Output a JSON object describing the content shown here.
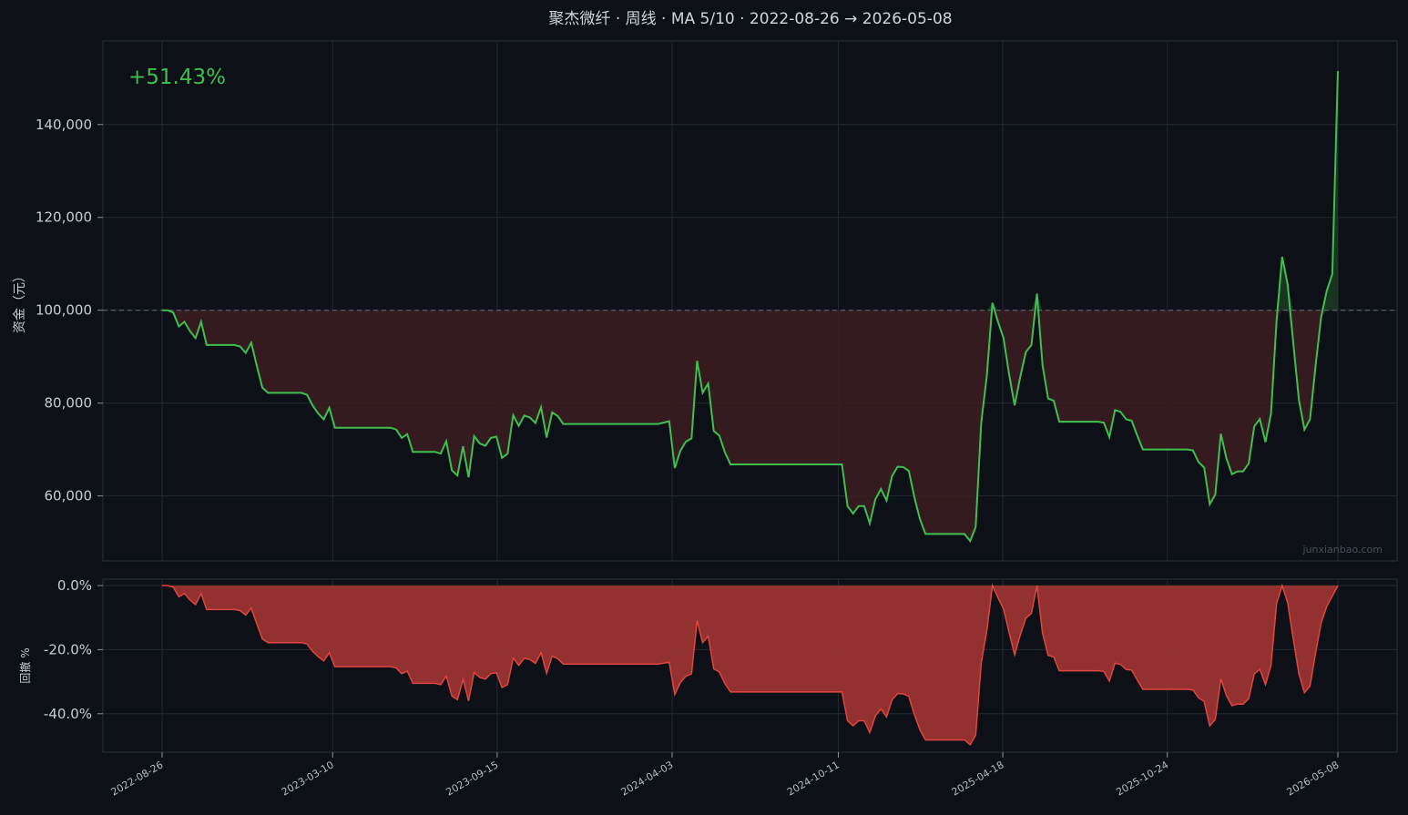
{
  "chart_data": [
    {
      "type": "line",
      "title": "聚杰微纤 · 周线 · MA 5/10 · 2022-08-26 → 2026-05-08",
      "ylabel": "资金（元）",
      "return_label": "+51.43%",
      "watermark": "junxianbao.com",
      "baseline": 100000,
      "ylim": [
        46000,
        158000
      ],
      "yticks": [
        60000,
        80000,
        100000,
        120000,
        140000
      ],
      "ytick_labels": [
        "60,000",
        "80,000",
        "100,000",
        "120,000",
        "140,000"
      ],
      "x_start": "2022-08-26",
      "x_end": "2026-05-08",
      "xticks": [
        "2022-08-26",
        "2023-03-10",
        "2023-09-15",
        "2024-04-03",
        "2024-10-11",
        "2025-04-18",
        "2025-10-24",
        "2026-05-08"
      ],
      "grid": true,
      "colors": {
        "line": "#3fbf4f",
        "fill_below": "#3a1d20",
        "fill_above": "#1b3a24",
        "baseline": "#666c78"
      },
      "series": [
        {
          "values": [
            100000,
            100000,
            99500,
            96500,
            97500,
            95500,
            94000,
            97500,
            92500,
            92500,
            92500,
            92500,
            92500,
            92500,
            92200,
            90800,
            93000,
            88000,
            83300,
            82200,
            82200,
            82200,
            82200,
            82200,
            82200,
            82200,
            81800,
            79500,
            77800,
            76500,
            79000,
            74700,
            74700,
            74700,
            74700,
            74700,
            74700,
            74700,
            74700,
            74700,
            74700,
            74700,
            74300,
            72500,
            73300,
            69500,
            69500,
            69500,
            69500,
            69500,
            69100,
            71800,
            65500,
            64400,
            70700,
            64000,
            72900,
            71300,
            70800,
            72500,
            72800,
            68200,
            69100,
            77400,
            75100,
            77300,
            76900,
            75700,
            79100,
            72600,
            78000,
            77200,
            75500,
            75500,
            75500,
            75500,
            75500,
            75500,
            75500,
            75500,
            75500,
            75500,
            75500,
            75500,
            75500,
            75500,
            75500,
            75500,
            75500,
            75500,
            75800,
            76100,
            66000,
            69700,
            71700,
            72400,
            89100,
            82200,
            84200,
            74000,
            73000,
            69400,
            66800,
            66800,
            66800,
            66800,
            66800,
            66800,
            66800,
            66800,
            66800,
            66800,
            66800,
            66800,
            66800,
            66800,
            66800,
            66800,
            66800,
            66800,
            66800,
            66800,
            66800,
            57800,
            56200,
            57800,
            57800,
            54100,
            59300,
            61500,
            59000,
            64300,
            66300,
            66200,
            65400,
            59700,
            55000,
            51800,
            51800,
            51800,
            51800,
            51800,
            51800,
            51800,
            51800,
            50300,
            53300,
            75800,
            85800,
            101600,
            97500,
            94000,
            86200,
            79500,
            85600,
            91000,
            92500,
            103600,
            88200,
            81000,
            80500,
            76000,
            76000,
            76000,
            76000,
            76000,
            76000,
            76000,
            76000,
            75800,
            72700,
            78500,
            78100,
            76500,
            76200,
            73000,
            70000,
            70000,
            70000,
            70000,
            70000,
            70000,
            70000,
            70000,
            70000,
            69800,
            67300,
            66100,
            58200,
            60300,
            73400,
            68100,
            64700,
            65300,
            65300,
            67000,
            75000,
            76600,
            71600,
            77800,
            97800,
            111500,
            105500,
            92800,
            80700,
            74300,
            76500,
            88000,
            98500,
            104200,
            107800,
            151500
          ],
          "drawdown": [
            0.0,
            0.0,
            -0.5,
            -3.5,
            -2.5,
            -4.5,
            -6.0,
            -2.5,
            -7.5,
            -7.5,
            -7.5,
            -7.5,
            -7.5,
            -7.5,
            -7.8,
            -9.2,
            -7.0,
            -12.0,
            -16.7,
            -17.8,
            -17.8,
            -17.8,
            -17.8,
            -17.8,
            -17.8,
            -17.8,
            -18.2,
            -20.5,
            -22.2,
            -23.5,
            -21.0,
            -25.3,
            -25.3,
            -25.3,
            -25.3,
            -25.3,
            -25.3,
            -25.3,
            -25.3,
            -25.3,
            -25.3,
            -25.3,
            -25.7,
            -27.5,
            -26.7,
            -30.5,
            -30.5,
            -30.5,
            -30.5,
            -30.5,
            -30.9,
            -28.2,
            -34.5,
            -35.6,
            -29.3,
            -36.0,
            -27.1,
            -28.7,
            -29.2,
            -27.5,
            -27.2,
            -31.8,
            -30.9,
            -22.6,
            -24.9,
            -22.7,
            -23.1,
            -24.3,
            -20.9,
            -27.4,
            -22.0,
            -22.8,
            -24.5,
            -24.5,
            -24.5,
            -24.5,
            -24.5,
            -24.5,
            -24.5,
            -24.5,
            -24.5,
            -24.5,
            -24.5,
            -24.5,
            -24.5,
            -24.5,
            -24.5,
            -24.5,
            -24.5,
            -24.5,
            -24.2,
            -23.9,
            -34.0,
            -30.3,
            -28.3,
            -27.6,
            -10.9,
            -17.8,
            -15.8,
            -26.0,
            -27.0,
            -30.6,
            -33.2,
            -33.2,
            -33.2,
            -33.2,
            -33.2,
            -33.2,
            -33.2,
            -33.2,
            -33.2,
            -33.2,
            -33.2,
            -33.2,
            -33.2,
            -33.2,
            -33.2,
            -33.2,
            -33.2,
            -33.2,
            -33.2,
            -33.2,
            -33.2,
            -42.2,
            -43.8,
            -42.2,
            -42.2,
            -45.9,
            -40.7,
            -38.5,
            -41.0,
            -35.7,
            -33.7,
            -33.8,
            -34.6,
            -40.3,
            -45.0,
            -48.2,
            -48.2,
            -48.2,
            -48.2,
            -48.2,
            -48.2,
            -48.2,
            -48.2,
            -49.7,
            -46.7,
            -24.2,
            -14.2,
            0.0,
            -3.8,
            -7.3,
            -14.7,
            -21.6,
            -15.5,
            -10.2,
            -8.7,
            0.0,
            -14.9,
            -21.8,
            -22.3,
            -26.6,
            -26.6,
            -26.6,
            -26.6,
            -26.6,
            -26.6,
            -26.6,
            -26.6,
            -26.8,
            -29.8,
            -24.2,
            -24.6,
            -26.2,
            -26.4,
            -29.5,
            -32.4,
            -32.4,
            -32.4,
            -32.4,
            -32.4,
            -32.4,
            -32.4,
            -32.4,
            -32.4,
            -32.6,
            -35.0,
            -36.2,
            -43.8,
            -41.8,
            -29.1,
            -34.3,
            -37.5,
            -37.0,
            -37.0,
            -35.3,
            -27.6,
            -26.1,
            -30.9,
            -24.9,
            -5.6,
            0.0,
            -5.4,
            -16.8,
            -27.6,
            -33.4,
            -31.4,
            -21.1,
            -11.7,
            -6.5,
            -3.3,
            0.0
          ]
        }
      ]
    },
    {
      "type": "area",
      "ylabel": "回撤 %",
      "ylim": [
        -52,
        2
      ],
      "yticks": [
        0,
        -20,
        -40
      ],
      "ytick_labels": [
        "0.0%",
        "-20.0%",
        "-40.0%"
      ],
      "colors": {
        "line": "#e0453f",
        "fill": "#9a3432"
      }
    }
  ]
}
